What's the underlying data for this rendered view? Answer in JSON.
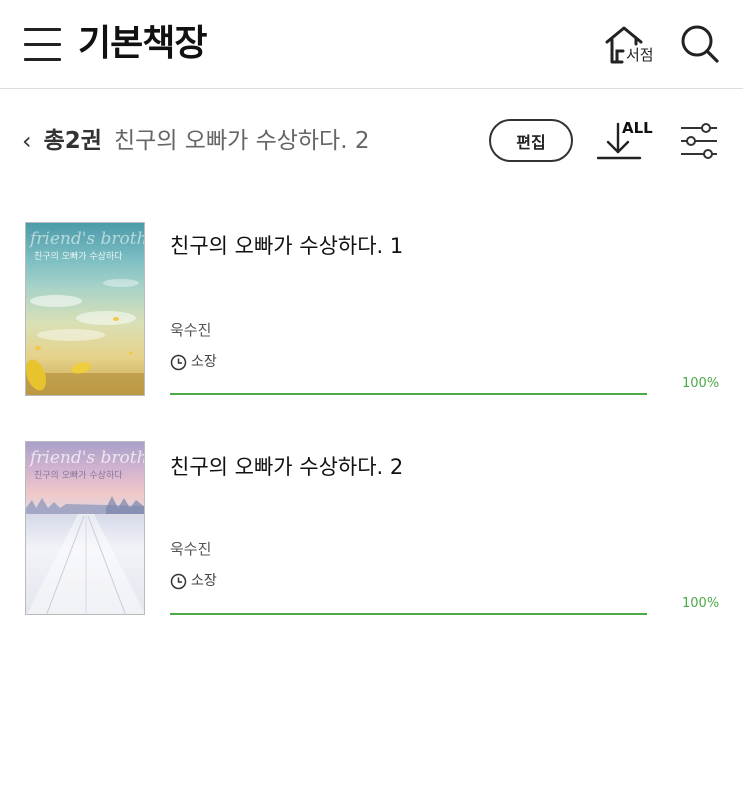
{
  "header": {
    "title": "기본책장",
    "store_label": "서점",
    "menu_icon": "hamburger-menu-icon",
    "search_icon": "search-icon"
  },
  "toolbar": {
    "back_icon": "chevron-left-icon",
    "count_text": "총2권",
    "series_title": "친구의 오빠가 수상하다. 2",
    "edit_label": "편집",
    "download_all_label": "ALL",
    "filter_icon": "sliders-icon"
  },
  "books": [
    {
      "title": "친구의 오빠가 수상하다. 1",
      "author": "욱수진",
      "status": "소장",
      "progress": 1.0,
      "progress_text": "100%",
      "cover_title_en": "friend's brother",
      "cover_title_ko": "친구의 오빠가 수상하다"
    },
    {
      "title": "친구의 오빠가 수상하다. 2",
      "author": "욱수진",
      "status": "소장",
      "progress": 1.0,
      "progress_text": "100%",
      "cover_title_en": "friend's brother",
      "cover_title_ko": "친구의 오빠가 수상하다"
    }
  ],
  "colors": {
    "accent_green": "#4caa46",
    "text_dark": "#222222",
    "divider": "#dedede"
  }
}
